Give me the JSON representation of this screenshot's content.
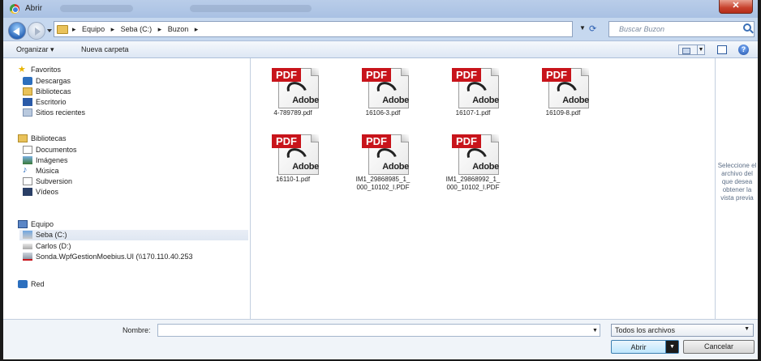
{
  "window": {
    "title": "Abrir",
    "close_label": "✕"
  },
  "address": {
    "crumbs": [
      "Equipo",
      "Seba (C:)",
      "Buzon"
    ],
    "search_placeholder": "Buscar Buzon"
  },
  "toolbar": {
    "organize_label": "Organizar ▾",
    "new_folder_label": "Nueva carpeta",
    "help_label": "?"
  },
  "nav": {
    "favorites": {
      "label": "Favoritos",
      "items": [
        "Descargas",
        "Bibliotecas",
        "Escritorio",
        "Sitios recientes"
      ]
    },
    "libraries": {
      "label": "Bibliotecas",
      "items": [
        "Documentos",
        "Imágenes",
        "Música",
        "Subversion",
        "Vídeos"
      ]
    },
    "computer": {
      "label": "Equipo",
      "items": [
        "Seba (C:)",
        "Carlos (D:)",
        "Sonda.WpfGestionMoebius.UI (\\\\170.110.40.253"
      ]
    },
    "network": {
      "label": "Red"
    },
    "selected": "Seba (C:)"
  },
  "files": [
    {
      "name": "4-789789.pdf",
      "line2": ""
    },
    {
      "name": "16106-3.pdf",
      "line2": ""
    },
    {
      "name": "16107-1.pdf",
      "line2": ""
    },
    {
      "name": "16109-8.pdf",
      "line2": ""
    },
    {
      "name": "16110-1.pdf",
      "line2": ""
    },
    {
      "name": "IM1_29868985_1_",
      "line2": "000_10102_I.PDF"
    },
    {
      "name": "IM1_29868992_1_",
      "line2": "000_10102_I.PDF"
    }
  ],
  "pdf_icon": {
    "band": "PDF",
    "brand": "Adobe"
  },
  "preview": {
    "text": "Seleccione el archivo del que desea obtener la vista previa"
  },
  "bottom": {
    "filename_label": "Nombre:",
    "filename_value": "",
    "filter_value": "Todos los archivos",
    "open_label": "Abrir",
    "cancel_label": "Cancelar"
  },
  "colors": {
    "pdf_red": "#c8141b",
    "window_frame": "#c6d8ef",
    "accent_blue": "#2a66b8"
  }
}
